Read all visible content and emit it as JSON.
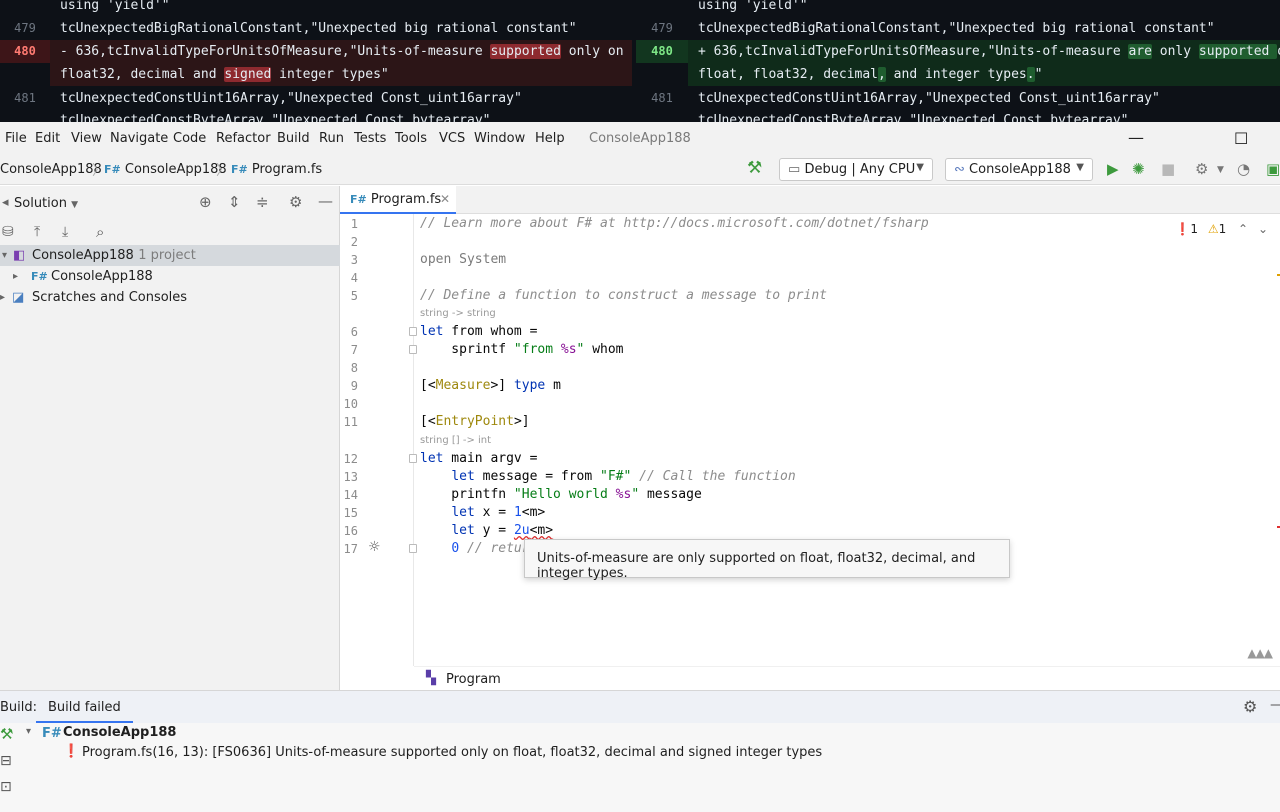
{
  "diff": {
    "left": [
      {
        "num": "",
        "text": "using 'yield'\"",
        "kind": "ctx"
      },
      {
        "num": "479",
        "text": " tcUnexpectedBigRationalConstant,\"Unexpected big rational constant\"",
        "kind": "ctx"
      },
      {
        "num": "480",
        "pre": "- 636,tcInvalidTypeForUnitsOfMeasure,\"Units-of-measure ",
        "hl1": "supported",
        "mid": " only on float,",
        "kind": "del"
      },
      {
        "num": "",
        "pre": "float32, decimal and ",
        "hl1": "signed",
        "mid": " integer types\"",
        "kind": "del"
      },
      {
        "num": "481",
        "text": " tcUnexpectedConstUint16Array,\"Unexpected Const_uint16array\"",
        "kind": "ctx"
      },
      {
        "num": "",
        "text": " tcUnexpectedConstByteArray,\"Unexpected Const_bytearray\"",
        "kind": "ctx"
      }
    ],
    "right": [
      {
        "num": "",
        "text": "using 'yield'\"",
        "kind": "ctx"
      },
      {
        "num": "479",
        "text": " tcUnexpectedBigRationalConstant,\"Unexpected big rational constant\"",
        "kind": "ctx"
      },
      {
        "num": "480",
        "pre": "+ 636,tcInvalidTypeForUnitsOfMeasure,\"Units-of-measure ",
        "hl1": "are",
        "mid": " only ",
        "hl2": "supported ",
        "post": "on",
        "kind": "add"
      },
      {
        "num": "",
        "pre": "float, float32, decimal",
        "hl1": ",",
        "mid": " and integer types",
        "hl2": ".",
        "post": "\"",
        "kind": "add"
      },
      {
        "num": "481",
        "text": " tcUnexpectedConstUint16Array,\"Unexpected Const_uint16array\"",
        "kind": "ctx"
      },
      {
        "num": "",
        "text": " tcUnexpectedConstByteArray,\"Unexpected Const_bytearray\"",
        "kind": "ctx"
      }
    ]
  },
  "menu": {
    "items": [
      "File",
      "Edit",
      "View",
      "Navigate",
      "Code",
      "Refactor",
      "Build",
      "Run",
      "Tests",
      "Tools",
      "VCS",
      "Window",
      "Help"
    ],
    "app_title": "ConsoleApp188"
  },
  "nav": {
    "crumb1": "ConsoleApp188",
    "crumb2": "ConsoleApp188",
    "crumb3": "Program.fs",
    "fs_badge": "F#",
    "config": "Debug | Any CPU",
    "run_target": "ConsoleApp188"
  },
  "solution": {
    "title": "Solution",
    "root": "ConsoleApp188",
    "root_meta": "· 1 project",
    "project": "ConsoleApp188",
    "scratches": "Scratches and Consoles"
  },
  "editor": {
    "tab": "Program.fs",
    "inspections": {
      "errors": "1",
      "warnings": "1"
    },
    "lines": {
      "l1": "// Learn more about F# at http://docs.microsoft.com/dotnet/fsharp",
      "l3": "open System",
      "l5": "// Define a function to construct a message to print",
      "hint6": "string -> string",
      "hint12": "string [] -> int"
    },
    "tooltip": "Units-of-measure are only supported on float, float32, decimal, and integer types.",
    "breadcrumb": "Program"
  },
  "build": {
    "label": "Build:",
    "tab": "Build failed",
    "project": "ConsoleApp188",
    "error": "Program.fs(16, 13): [FS0636] Units-of-measure supported only on float, float32, decimal and signed integer types"
  },
  "colors": {
    "accent": "#3574f0",
    "error": "#e03030",
    "run": "#3d9a3d"
  }
}
